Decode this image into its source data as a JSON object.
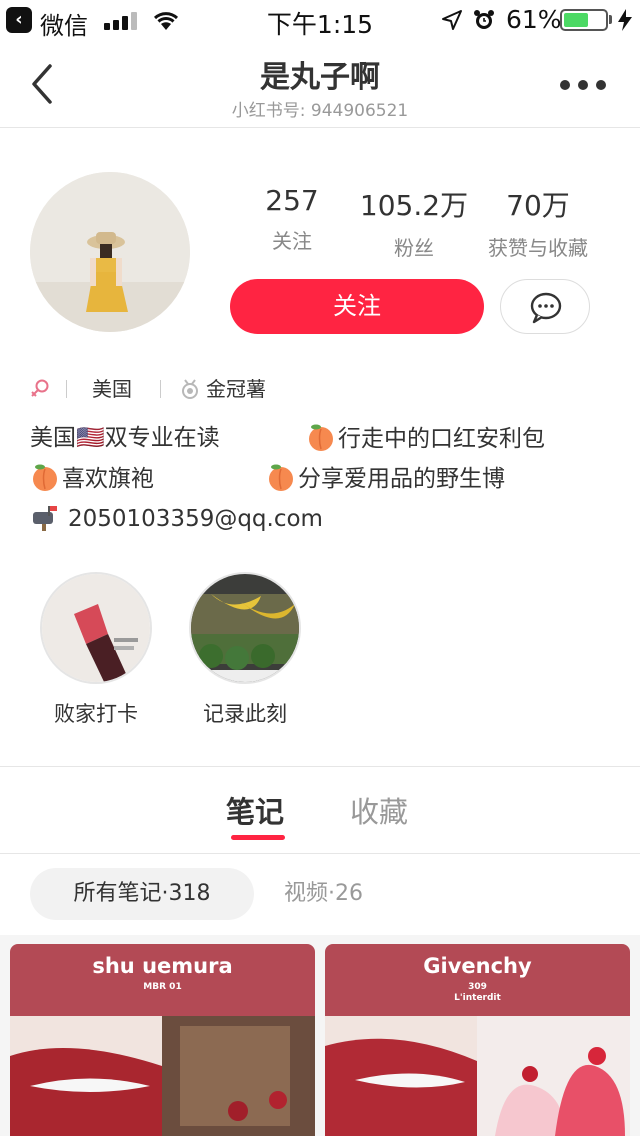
{
  "status_bar": {
    "back_app": "微信",
    "time": "下午1:15",
    "battery": "61%",
    "battery_level": 0.61
  },
  "nav": {
    "title": "是丸子啊",
    "subtitle": "小红书号: 944906521"
  },
  "profile": {
    "stats": [
      {
        "value": "257",
        "label": "关注"
      },
      {
        "value": "105.2万",
        "label": "粉丝"
      },
      {
        "value": "70万",
        "label": "获赞与收藏"
      }
    ],
    "follow_label": "关注",
    "tags": {
      "location": "美国",
      "level": "金冠薯"
    },
    "bio": {
      "line1_a": "美国🇺🇸双专业在读",
      "line1_b": "行走中的口红安利包",
      "line2_a": "喜欢旗袍",
      "line2_b": "分享爱用品的野生博",
      "line3": "2050103359@qq.com"
    }
  },
  "highlights": [
    {
      "label": "败家打卡"
    },
    {
      "label": "记录此刻"
    }
  ],
  "tabs": {
    "notes": "笔记",
    "favorites": "收藏"
  },
  "filters": {
    "all": "所有笔记·318",
    "video": "视频·26"
  },
  "cards": [
    {
      "brand": "shu uemura",
      "sub": "MBR 01",
      "sub2": ""
    },
    {
      "brand": "Givenchy",
      "sub": "309",
      "sub2": "L'interdit"
    }
  ],
  "colors": {
    "accent": "#ff2442",
    "card_header": "#b34a55"
  }
}
